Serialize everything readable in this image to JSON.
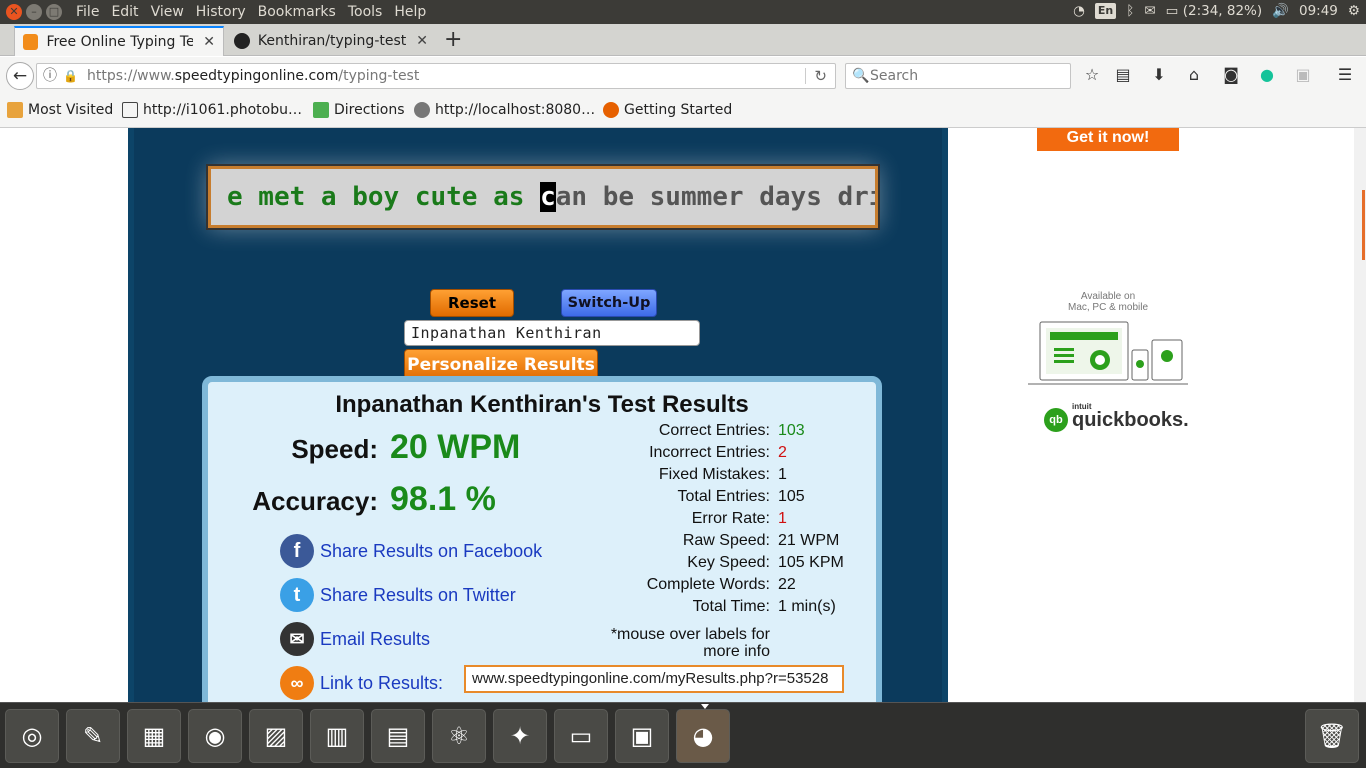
{
  "system": {
    "menu": [
      "File",
      "Edit",
      "View",
      "History",
      "Bookmarks",
      "Tools",
      "Help"
    ],
    "keyboard": "En",
    "battery": "(2:34, 82%)",
    "clock": "09:49"
  },
  "tabs": [
    {
      "label": "Free Online Typing Tes",
      "active": true
    },
    {
      "label": "Kenthiran/typing-test",
      "active": false
    }
  ],
  "urlbar": {
    "prefix": "https://www.",
    "domain": "speedtypingonline.com",
    "path": "/typing-test"
  },
  "search": {
    "placeholder": "Search"
  },
  "bookmarks": [
    {
      "label": "Most Visited"
    },
    {
      "label": "http://i1061.photobu…"
    },
    {
      "label": "Directions"
    },
    {
      "label": "http://localhost:8080…"
    },
    {
      "label": "Getting Started"
    }
  ],
  "typing": {
    "typed": "e met a boy cute as ",
    "cursor": "c",
    "pending": "an be summer days dri"
  },
  "controls": {
    "reset": "Reset",
    "switch_up": "Switch-Up",
    "name_value": "Inpanathan Kenthiran",
    "personalize": "Personalize Results"
  },
  "results": {
    "title": "Inpanathan Kenthiran's Test Results",
    "speed_label": "Speed:",
    "speed_value": "20 WPM",
    "accuracy_label": "Accuracy:",
    "accuracy_value": "98.1 %",
    "stats": [
      {
        "label": "Correct Entries:",
        "value": "103",
        "color": "#1a8a1a"
      },
      {
        "label": "Incorrect Entries:",
        "value": "2",
        "color": "#d01010"
      },
      {
        "label": "Fixed Mistakes:",
        "value": "1",
        "color": "#111111"
      },
      {
        "label": "Total Entries:",
        "value": "105",
        "color": "#111111"
      },
      {
        "label": "Error Rate:",
        "value": "1",
        "color": "#d01010"
      },
      {
        "label": "Raw Speed:",
        "value": "21 WPM",
        "color": "#111111"
      },
      {
        "label": "Key Speed:",
        "value": "105 KPM",
        "color": "#111111"
      },
      {
        "label": "Complete Words:",
        "value": "22",
        "color": "#111111"
      },
      {
        "label": "Total Time:",
        "value": "1 min(s)",
        "color": "#111111"
      }
    ],
    "note": "*mouse over labels for more info",
    "share_facebook": "Share Results on Facebook",
    "share_twitter": "Share Results on Twitter",
    "email": "Email Results",
    "link_label": "Link to Results:",
    "link_value": "www.speedtypingonline.com/myResults.php?r=53528"
  },
  "ad": {
    "cta": "Get it now!",
    "available_line1": "Available on",
    "available_line2": "Mac, PC & mobile",
    "brand_prefix": "intuit",
    "brand": "quickbooks."
  },
  "dock": [
    "ubuntu-dash",
    "pdf-viewer",
    "image-viewer",
    "camera",
    "impress",
    "calc",
    "files",
    "atom",
    "compass",
    "terminal",
    "workspace",
    "firefox"
  ]
}
